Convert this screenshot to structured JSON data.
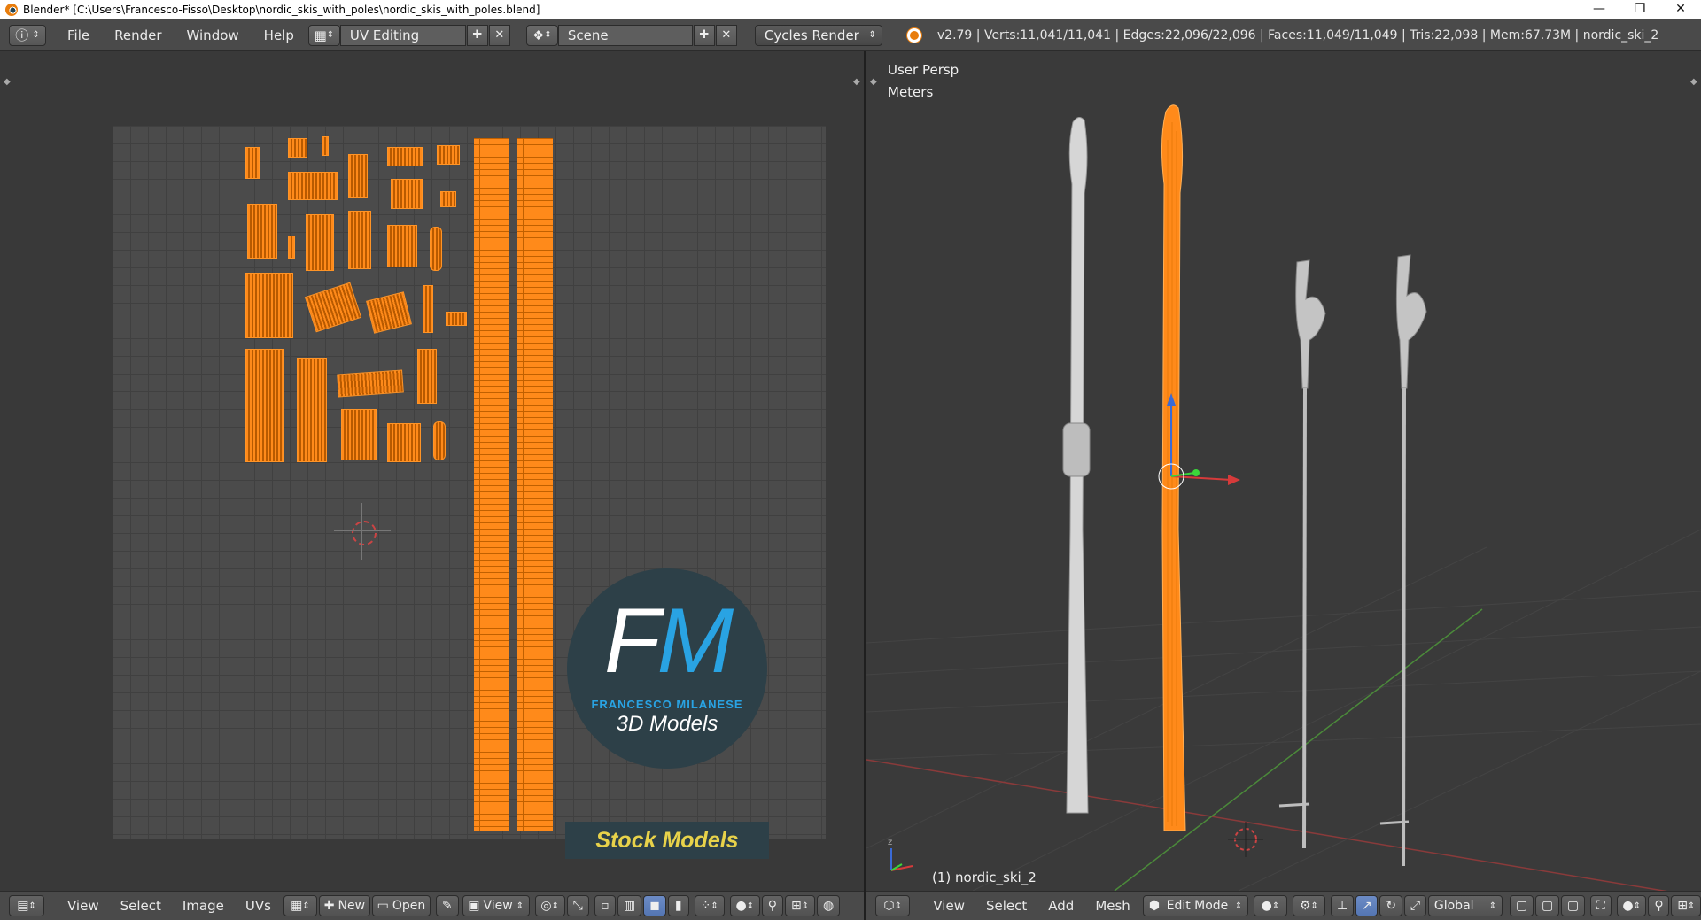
{
  "window": {
    "title": "Blender* [C:\\Users\\Francesco-Fisso\\Desktop\\nordic_skis_with_poles\\nordic_skis_with_poles.blend]",
    "controls": {
      "minimize": "—",
      "restore": "❐",
      "close": "✕"
    }
  },
  "info_header": {
    "menus": [
      "File",
      "Render",
      "Window",
      "Help"
    ],
    "layout": "UV Editing",
    "scene": "Scene",
    "engine": "Cycles Render",
    "stats": "v2.79 | Verts:11,041/11,041 | Edges:22,096/22,096 | Faces:11,049/11,049 | Tris:22,098 | Mem:67.73M | nordic_ski_2"
  },
  "viewport": {
    "view_name": "User Persp",
    "units": "Meters",
    "object_label": "(1) nordic_ski_2"
  },
  "watermark": {
    "letter_f": "F",
    "letter_m": "M",
    "name": "FRANCESCO MILANESE",
    "subtitle": "3D Models",
    "banner": "Stock Models"
  },
  "uv_header": {
    "menus": [
      "View",
      "Select",
      "Image",
      "UVs"
    ],
    "new_label": "New",
    "open_label": "Open",
    "view_label": "View"
  },
  "view3d_header": {
    "menus": [
      "View",
      "Select",
      "Add",
      "Mesh"
    ],
    "mode": "Edit Mode",
    "orientation": "Global"
  },
  "colors": {
    "selection_orange": "#ff8a1a",
    "logo_blue": "#29a3e3",
    "logo_bg": "#2d4048",
    "banner_text": "#e8d24a"
  }
}
